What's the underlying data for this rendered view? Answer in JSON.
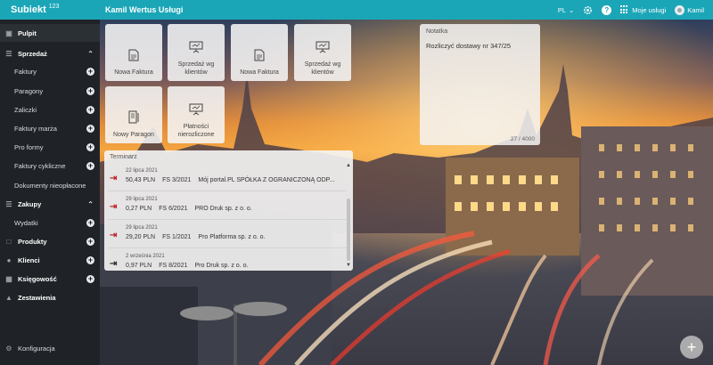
{
  "app": {
    "logo_text": "Subiekt",
    "logo_sup": "123",
    "company": "Kamil Wertus Usługi"
  },
  "topbar": {
    "language": "PL",
    "help_icon": "question-icon",
    "settings_icon": "gear-icon",
    "services_label": "Moje usługi",
    "user_name": "Kamil"
  },
  "sidebar": {
    "items": [
      {
        "label": "Pulpit",
        "icon": "monitor-icon",
        "type": "active"
      },
      {
        "label": "Sprzedaż",
        "icon": "cart-icon",
        "type": "group"
      },
      {
        "label": "Faktury",
        "type": "sub"
      },
      {
        "label": "Paragony",
        "type": "sub"
      },
      {
        "label": "Zaliczki",
        "type": "sub"
      },
      {
        "label": "Faktury marża",
        "type": "sub"
      },
      {
        "label": "Pro formy",
        "type": "sub"
      },
      {
        "label": "Faktury cykliczne",
        "type": "sub"
      },
      {
        "label": "Dokumenty nieopłacone",
        "type": "sub"
      },
      {
        "label": "Zakupy",
        "icon": "cart-down-icon",
        "type": "group"
      },
      {
        "label": "Wydatki",
        "type": "sub"
      },
      {
        "label": "Produkty",
        "icon": "box-icon",
        "type": "top"
      },
      {
        "label": "Klienci",
        "icon": "users-icon",
        "type": "top"
      },
      {
        "label": "Księgowość",
        "icon": "ledger-icon",
        "type": "top"
      },
      {
        "label": "Zestawienia",
        "icon": "chart-icon",
        "type": "top"
      },
      {
        "label": "Konfiguracja",
        "icon": "gear-icon",
        "type": "top"
      }
    ]
  },
  "tiles": [
    {
      "label": "Nowa Faktura",
      "icon": "document-icon"
    },
    {
      "label": "Sprzedaż wg klientów",
      "icon": "presentation-icon"
    },
    {
      "label": "Nowa Faktura",
      "icon": "document-icon"
    },
    {
      "label": "Sprzedaż wg klientów",
      "icon": "presentation-icon"
    },
    {
      "label": "Nowy Paragon",
      "icon": "receipt-icon"
    },
    {
      "label": "Płatności nierozliczone",
      "icon": "presentation-icon"
    }
  ],
  "note": {
    "title": "Notatka",
    "text": "Rozliczyć dostawy nr 347/25",
    "counter": "27 / 4000"
  },
  "calendar": {
    "title": "Terminarz",
    "entries": [
      {
        "date": "22 lipca 2021",
        "amount": "50,43 PLN",
        "doc": "FS 3/2021",
        "client": "Mój portal.PL SPÓŁKA Z OGRANICZONĄ ODP...",
        "dir": "in",
        "color": "#c0282d"
      },
      {
        "date": "29 lipca 2021",
        "amount": "0,27 PLN",
        "doc": "FS 6/2021",
        "client": "PRO Druk sp. z o. o.",
        "dir": "in",
        "color": "#c0282d"
      },
      {
        "date": "29 lipca 2021",
        "amount": "29,20 PLN",
        "doc": "FS 1/2021",
        "client": "Pro Platforma sp. z o. o.",
        "dir": "in",
        "color": "#c0282d"
      },
      {
        "date": "2 września 2021",
        "amount": "0,97 PLN",
        "doc": "FS 8/2021",
        "client": "Pro Druk sp. z o. o.",
        "dir": "in",
        "color": "#333333"
      }
    ]
  },
  "fab_label": "+"
}
